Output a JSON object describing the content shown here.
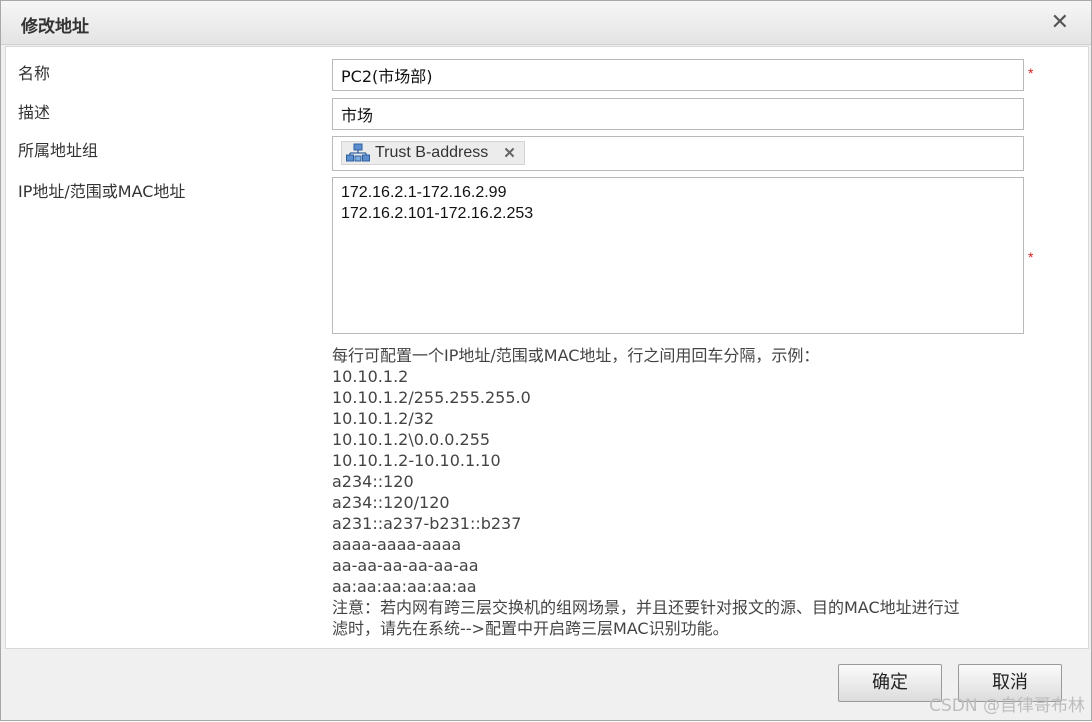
{
  "dialog": {
    "title": "修改地址",
    "close_symbol": "✕"
  },
  "form": {
    "name": {
      "label": "名称",
      "value": "PC2(市场部)",
      "required_mark": "*"
    },
    "description": {
      "label": "描述",
      "value": "市场"
    },
    "group": {
      "label": "所属地址组",
      "tag_label": "Trust B-address",
      "tag_icon": "network-group-icon",
      "remove_symbol": "✕"
    },
    "ip": {
      "label": "IP地址/范围或MAC地址",
      "lines": [
        "172.16.2.1-172.16.2.99",
        "172.16.2.101-172.16.2.253"
      ],
      "required_mark": "*"
    }
  },
  "help": {
    "intro": "每行可配置一个IP地址/范围或MAC地址，行之间用回车分隔，示例：",
    "examples": [
      "10.10.1.2",
      "10.10.1.2/255.255.255.0",
      "10.10.1.2/32",
      "10.10.1.2\\0.0.0.255",
      "10.10.1.2-10.10.1.10",
      "a234::120",
      "a234::120/120",
      "a231::a237-b231::b237",
      "aaaa-aaaa-aaaa",
      "aa-aa-aa-aa-aa-aa",
      "aa:aa:aa:aa:aa:aa"
    ],
    "note_line1": "注意：若内网有跨三层交换机的组网场景，并且还要针对报文的源、目的MAC地址进行过",
    "note_line2": "滤时，请先在系统-->配置中开启跨三层MAC识别功能。"
  },
  "buttons": {
    "ok": "确定",
    "cancel": "取消"
  },
  "watermark": "CSDN @自律哥布林",
  "colors": {
    "required": "#e02020",
    "dialog_bg": "#f0f0f0",
    "body_bg": "#ffffff"
  }
}
